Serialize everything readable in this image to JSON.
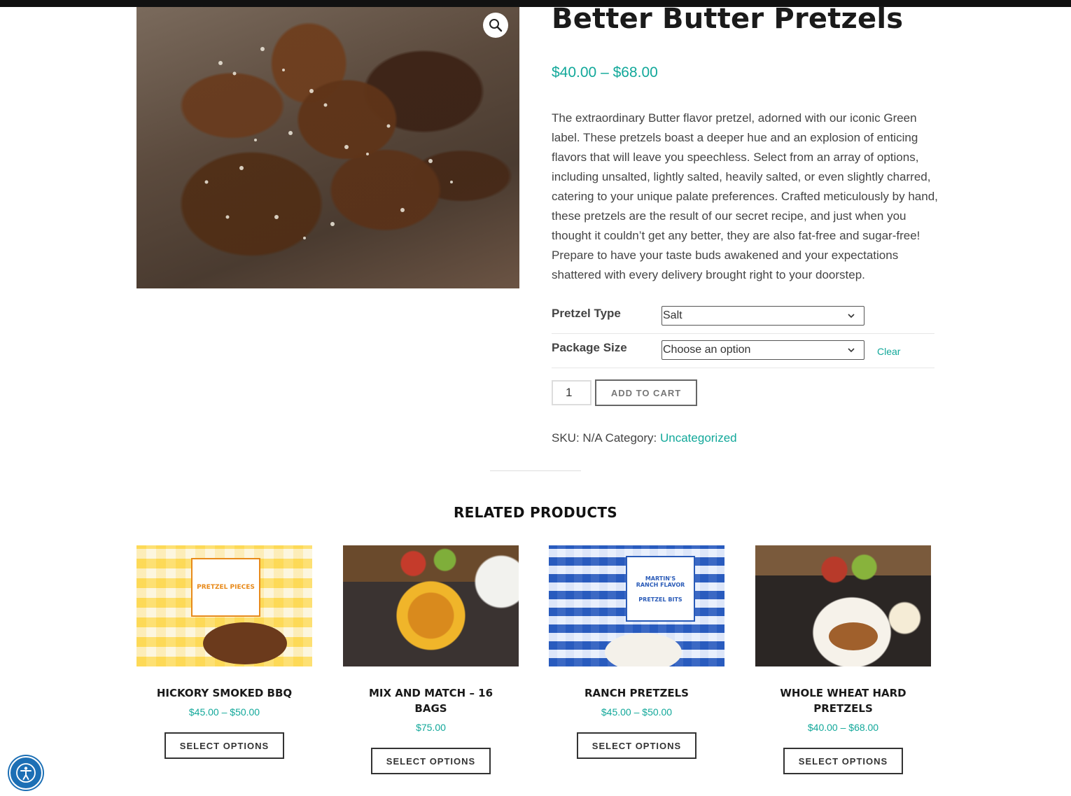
{
  "product": {
    "title": "Better Butter Pretzels",
    "price_range": "$40.00 – $68.00",
    "description": "The extraordinary Butter flavor pretzel, adorned with our iconic Green label. These pretzels boast a deeper hue and an explosion of enticing flavors that will leave you speechless. Select from an array of options, including unsalted, lightly salted, heavily salted, or even slightly charred, catering to your unique palate preferences. Crafted meticulously by hand, these pretzels are the result of our secret recipe, and just when you thought it couldn’t get any better, they are also fat-free and sugar-free! Prepare to have your taste buds awakened and your expectations shattered with every delivery brought right to your doorstep.",
    "zoom_icon": "magnifier-icon"
  },
  "variations": {
    "pretzel_type": {
      "label": "Pretzel Type",
      "selected": "Salt"
    },
    "package_size": {
      "label": "Package Size",
      "selected": "Choose an option"
    },
    "clear_label": "Clear"
  },
  "cart": {
    "quantity": "1",
    "add_label": "ADD TO CART"
  },
  "meta": {
    "sku_label": "SKU:",
    "sku_value": "N/A",
    "category_label": "Category:",
    "category_value": "Uncategorized"
  },
  "related": {
    "heading": "RELATED PRODUCTS",
    "items": [
      {
        "title": "HICKORY SMOKED BBQ",
        "price": "$45.00 – $50.00",
        "button": "SELECT OPTIONS",
        "label_text": "PRETZEL PIECES"
      },
      {
        "title": "MIX AND MATCH – 16 BAGS",
        "price": "$75.00",
        "button": "SELECT OPTIONS"
      },
      {
        "title": "RANCH PRETZELS",
        "price": "$45.00 – $50.00",
        "button": "SELECT OPTIONS",
        "label_text": "PRETZEL BITS",
        "brand_text": "MARTIN'S RANCH FLAVOR"
      },
      {
        "title": "WHOLE WHEAT HARD PRETZELS",
        "price": "$40.00 – $68.00",
        "button": "SELECT OPTIONS"
      }
    ]
  },
  "colors": {
    "accent": "#12a89a",
    "accessibility": "#1c6fb5"
  },
  "accessibility": {
    "icon": "accessibility-icon"
  }
}
